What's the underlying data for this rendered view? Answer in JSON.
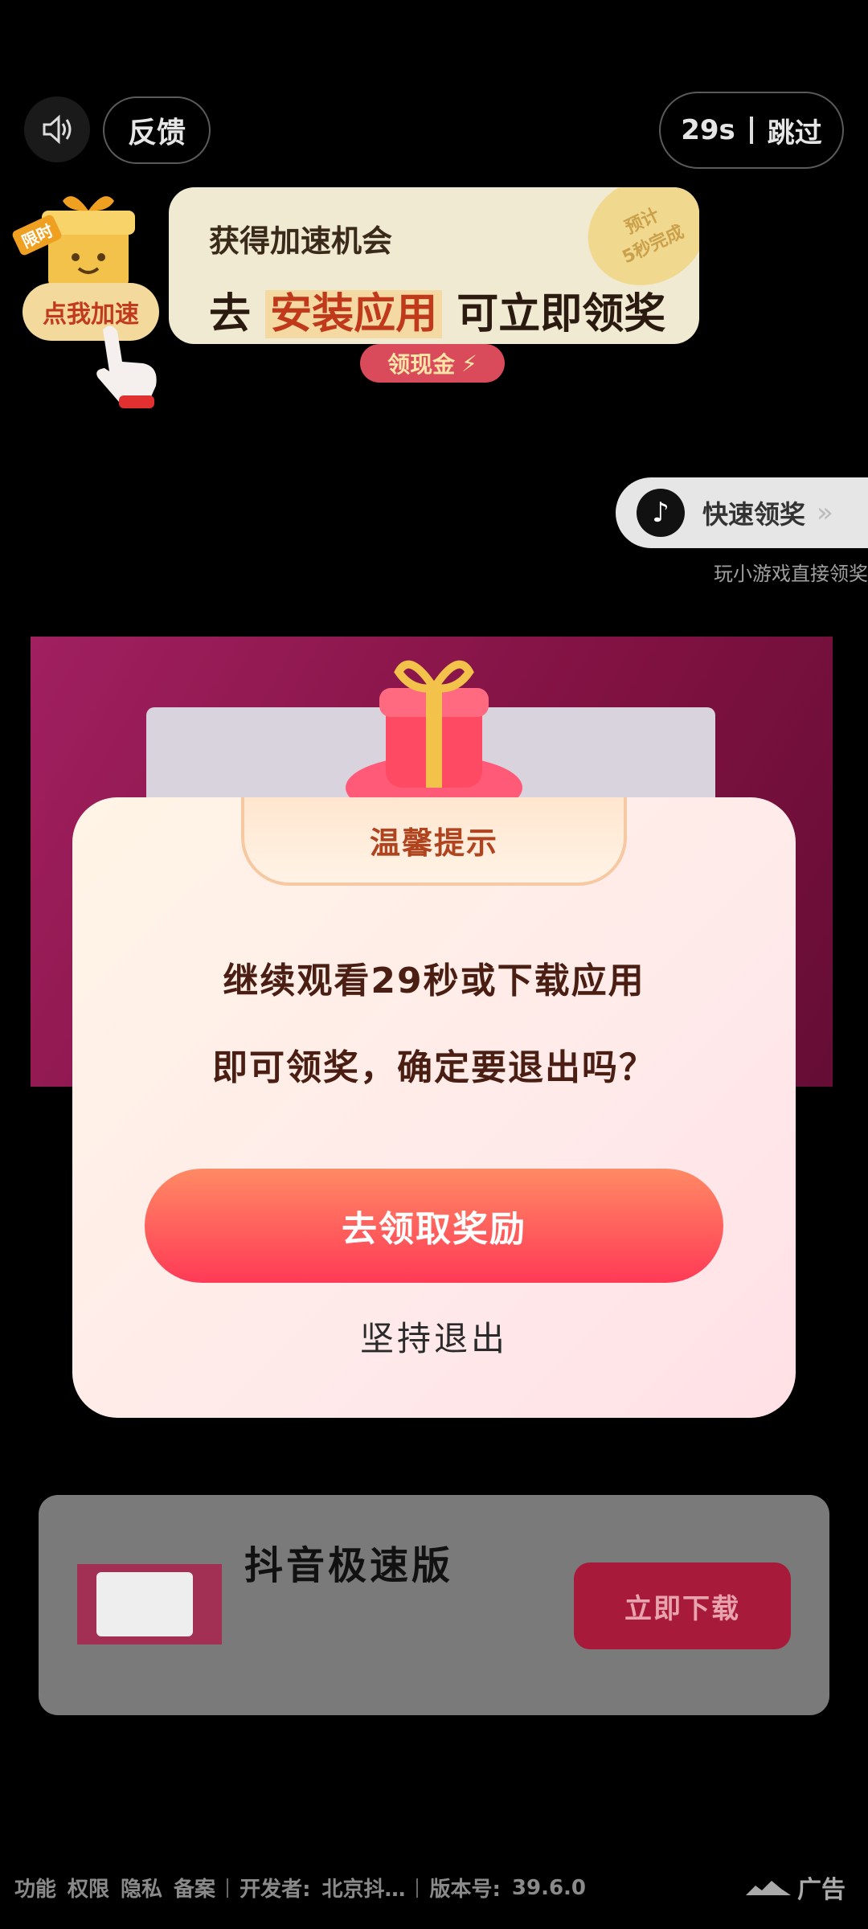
{
  "top": {
    "feedback_label": "反馈",
    "skip_seconds": "29s",
    "skip_label": "跳过",
    "sound_icon": "speaker-icon"
  },
  "banner": {
    "line1": "获得加速机会",
    "line2_prefix": "去",
    "line2_highlight": "安装应用",
    "line2_suffix": "可立即领奖",
    "seal_line1": "预计",
    "seal_line2": "5秒完成",
    "speed_button": "点我加速",
    "limit_tag": "限时",
    "cash_label": "领现金"
  },
  "quick_reward": {
    "label": "快速领奖",
    "chevron": "»",
    "subtitle": "玩小游戏直接领奖",
    "logo_icon": "tiktok-logo-icon"
  },
  "modal": {
    "title": "温馨提示",
    "message_line1": "继续观看29秒或下载应用",
    "message_line2": "即可领奖，确定要退出吗？",
    "primary_button": "去领取奖励",
    "secondary_button": "坚持退出"
  },
  "ad_card": {
    "app_name": "抖音极速版",
    "download_button": "立即下载"
  },
  "footer": {
    "links": [
      "功能",
      "权限",
      "隐私",
      "备案"
    ],
    "developer_label": "开发者:",
    "developer_value": "北京抖…",
    "version_label": "版本号:",
    "version_value": "39.6.0",
    "ad_label": "广告"
  },
  "colors": {
    "accent_red": "#ff3a56",
    "modal_title": "#b0441f",
    "download_bg": "#a81a3a"
  }
}
